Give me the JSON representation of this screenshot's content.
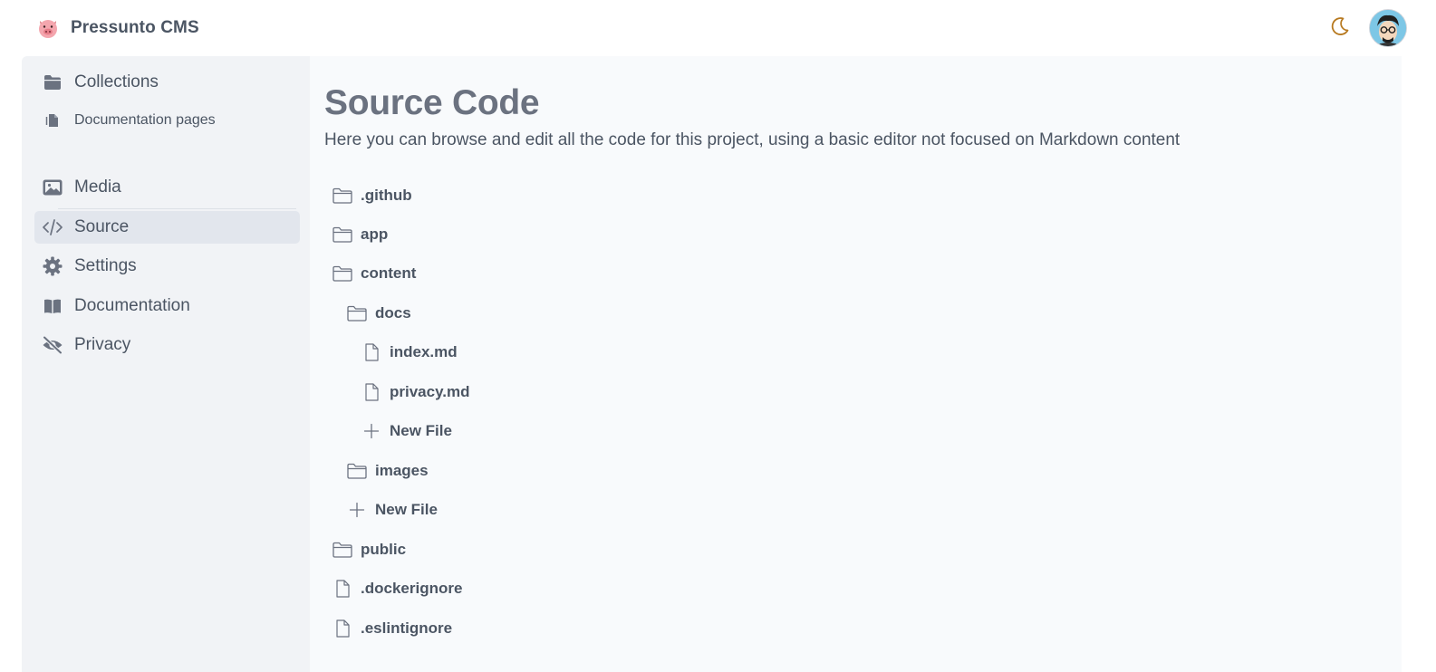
{
  "header": {
    "app_name": "Pressunto CMS",
    "logo_icon": "pig-face-icon",
    "theme_toggle_icon": "moon-icon",
    "avatar_icon": "user-avatar"
  },
  "sidebar": {
    "items": [
      {
        "label": "Collections",
        "icon": "folder-icon"
      },
      {
        "label": "Documentation pages",
        "icon": "document-icon"
      },
      {
        "label": "Media",
        "icon": "image-icon"
      },
      {
        "label": "Source",
        "icon": "code-icon",
        "active": true
      },
      {
        "label": "Settings",
        "icon": "gear-icon"
      },
      {
        "label": "Documentation",
        "icon": "book-icon"
      },
      {
        "label": "Privacy",
        "icon": "eye-off-icon"
      }
    ]
  },
  "main": {
    "title": "Source Code",
    "description": "Here you can browse and edit all the code for this project, using a basic editor not focused on Markdown content",
    "tree": [
      {
        "label": ".github",
        "type": "folder",
        "depth": 0
      },
      {
        "label": "app",
        "type": "folder",
        "depth": 0
      },
      {
        "label": "content",
        "type": "folder",
        "depth": 0
      },
      {
        "label": "docs",
        "type": "folder",
        "depth": 1
      },
      {
        "label": "index.md",
        "type": "file",
        "depth": 2
      },
      {
        "label": "privacy.md",
        "type": "file",
        "depth": 2
      },
      {
        "label": "New File",
        "type": "new",
        "depth": 2
      },
      {
        "label": "images",
        "type": "folder",
        "depth": 1
      },
      {
        "label": "New File",
        "type": "new",
        "depth": 1
      },
      {
        "label": "public",
        "type": "folder",
        "depth": 0
      },
      {
        "label": ".dockerignore",
        "type": "file",
        "depth": 0
      },
      {
        "label": ".eslintignore",
        "type": "file",
        "depth": 0
      }
    ]
  },
  "colors": {
    "accent_moon": "#b7791f",
    "text": "#4b5563",
    "title": "#6b7280",
    "active_bg": "#e2e6ed"
  }
}
